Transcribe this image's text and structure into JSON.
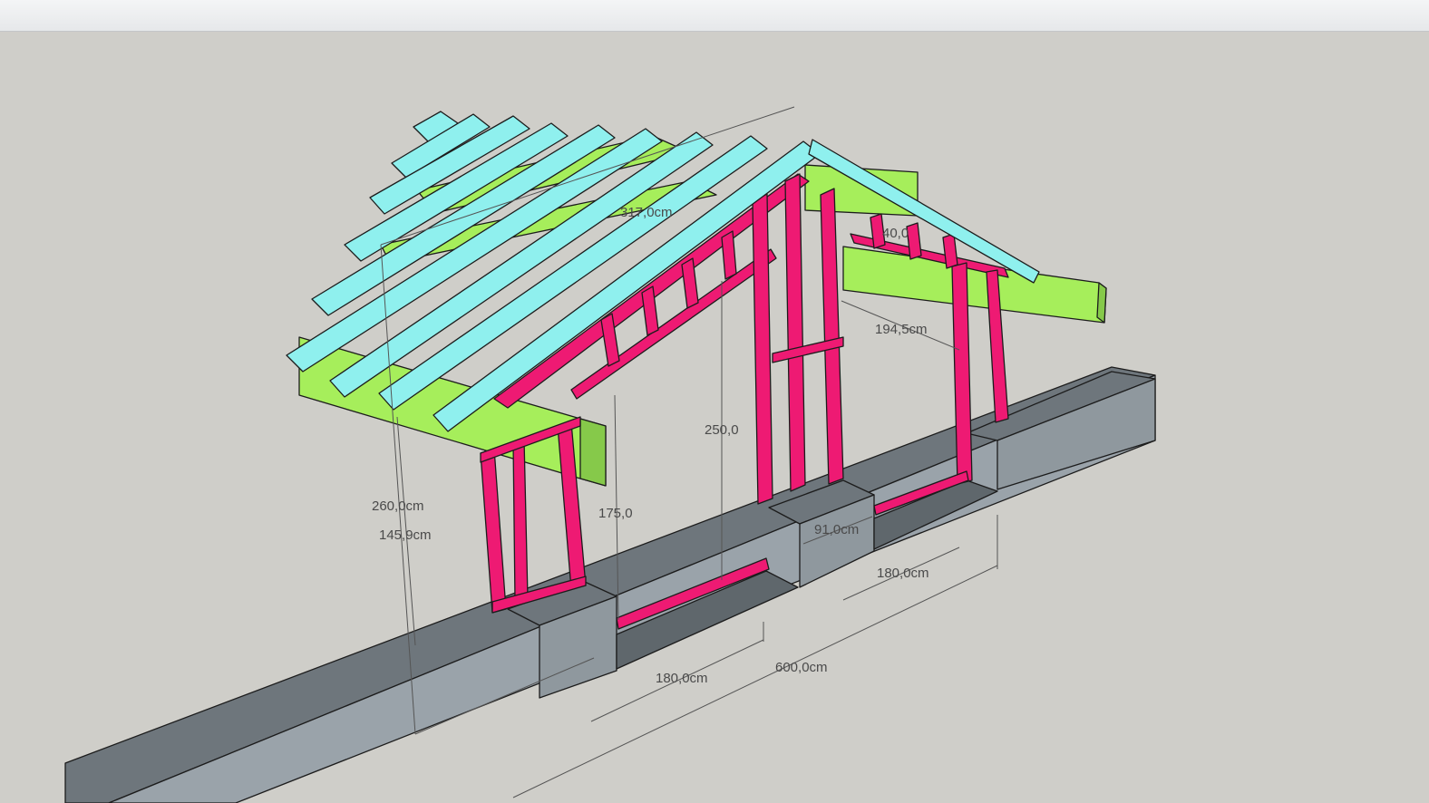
{
  "colors": {
    "background": "#cfcec9",
    "rafter": "#8ff0ee",
    "purlin_beam": "#a6ee5b",
    "stud_frame": "#ee1a73",
    "concrete_base": "#9aa3aa"
  },
  "dimensions": {
    "overall_height": "260,0cm",
    "eave_height": "145,9cm",
    "opening_left_height": "175,0",
    "opening_center_height": "250,0",
    "ridge_length": "317,0cm",
    "right_span": "194,5cm",
    "wall_offset": "91,0cm",
    "opening_right_width": "180,0cm",
    "opening_left_width": "180,0cm",
    "total_length": "600,0cm",
    "rafter_spacing": "40,0"
  }
}
